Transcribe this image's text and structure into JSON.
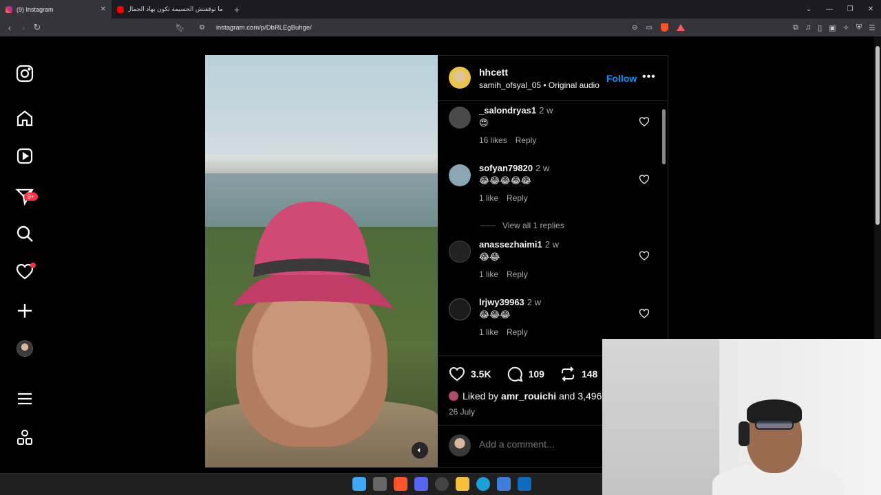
{
  "browser": {
    "tabs": [
      {
        "title": "(9) Instagram",
        "active": true
      },
      {
        "title": "ما توقفتش الحسيمة تكون بهاد الجمال |",
        "active": false
      }
    ],
    "url": "instagram.com/p/DbRLEgBuhge/"
  },
  "sidebar": {
    "notifications_badge": "9+"
  },
  "post": {
    "username": "hhcett",
    "audio_line": "samih_ofsyal_05 • Original audio",
    "follow_label": "Follow",
    "more_label": "•••"
  },
  "comments": [
    {
      "user": "_salondryas1",
      "time": "2 w",
      "text": "😍",
      "likes": "16 likes",
      "reply": "Reply"
    },
    {
      "user": "sofyan79820",
      "time": "2 w",
      "text": "😂😂😂😂😂",
      "likes": "1 like",
      "reply": "Reply"
    },
    {
      "user": "anassezhaimi1",
      "time": "2 w",
      "text": "😂😂",
      "likes": "1 like",
      "reply": "Reply"
    },
    {
      "user": "lrjwy39963",
      "time": "2 w",
      "text": "😂😂😂",
      "likes": "1 like",
      "reply": "Reply"
    }
  ],
  "view_replies_label": "View all 1 replies",
  "stats": {
    "likes": "3.5K",
    "comments": "109",
    "reposts": "148"
  },
  "liked_by": {
    "prefix": "Liked by",
    "user": "amr_rouichi",
    "suffix": "and 3,496"
  },
  "date": "26 July",
  "add_comment_placeholder": "Add a comment...",
  "colors": {
    "accent": "#0095f6",
    "badge": "#ff3040",
    "background": "#000000"
  }
}
